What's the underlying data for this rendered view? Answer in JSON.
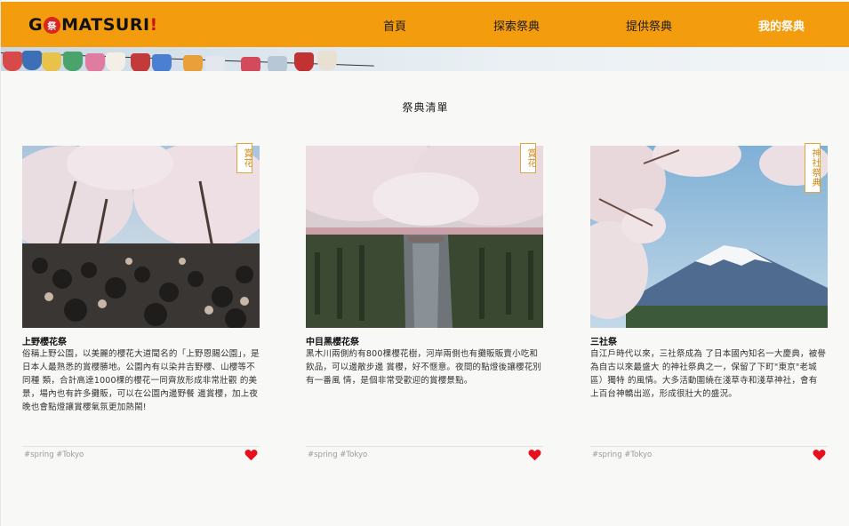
{
  "brand": {
    "logo_pre": "G",
    "logo_badge": "祭",
    "logo_main": " MATSURI",
    "logo_bang": "!"
  },
  "nav": {
    "home": "首頁",
    "explore": "探索祭典",
    "provide": "提供祭典",
    "mine": "我的祭典"
  },
  "section_title": "祭典清單",
  "cards": [
    {
      "tag": "賞花",
      "title": "上野櫻花祭",
      "desc": "俗稱上野公園，以美麗的櫻花大道聞名的「上野恩賜公園」，是日本人最熟悉的賞櫻勝地。公園內有以染井吉野櫻、山櫻等不同種 類，合計高達1000棵的櫻花一同齊放形成非常壯觀 的美景，場內也有許多攤販，可以在公園內邊野餐 邊賞櫻，加上夜晚也會點燈讓賞櫻氣氛更加熱鬧!",
      "hashtags": "#spring #Tokyo",
      "heart_icon": "heart-icon"
    },
    {
      "tag": "賞花",
      "title": "中目黑櫻花祭",
      "desc": "黑木川兩側約有800棵櫻花樹，河岸兩側也有攤販販賣小吃和飲品，可以邊散步邊 賞櫻，好不愜意。夜間的點燈後讓櫻花別有一番風 情，是個非常受歡迎的賞櫻景點。",
      "hashtags": "#spring #Tokyo",
      "heart_icon": "heart-icon"
    },
    {
      "tag": "神社祭典",
      "title": "三社祭",
      "desc": "自江戶時代以來，三社祭成為 了日本國內知名一大慶典，被譽為自古以來最盛大 的神社祭典之一，保留了下町\"東京\"老城區）獨特 的風情。大多活動圍繞在淺草寺和淺草神社，會有 上百台神轎出巡，形成很壯大的盛況。",
      "hashtags": "#spring #Tokyo",
      "heart_icon": "heart-icon"
    }
  ],
  "colors": {
    "nav_bg": "#f39c0e",
    "heart": "#e8101c",
    "tag": "#d08a12"
  }
}
